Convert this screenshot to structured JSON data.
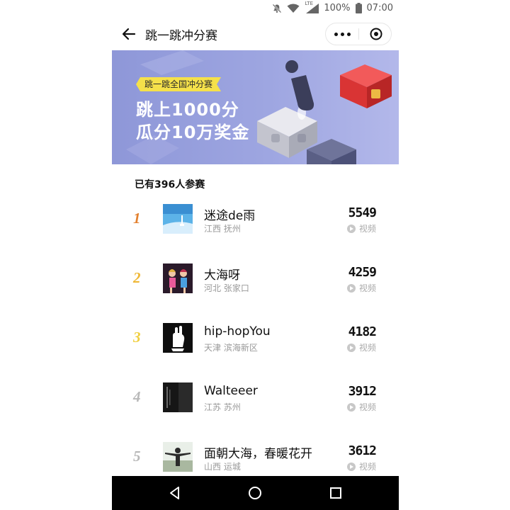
{
  "status_bar": {
    "battery": "100%",
    "time": "07:00",
    "network": "LTE"
  },
  "header": {
    "title": "跳一跳冲分赛"
  },
  "banner": {
    "ribbon": "跳一跳全国冲分赛",
    "line1": "跳上1000分",
    "line2": "瓜分10万奖金",
    "colors": {
      "background": "#9ea6e1",
      "ribbon": "#f5e14a"
    }
  },
  "participants": "已有396人参赛",
  "ranking": [
    {
      "rank": "1",
      "name": "迷途de雨",
      "location": "江西 抚州",
      "score": "5549",
      "video_label": "视频",
      "rank_color": "#e3812f"
    },
    {
      "rank": "2",
      "name": "大海呀",
      "location": "河北 张家口",
      "score": "4259",
      "video_label": "视频",
      "rank_color": "#efb735"
    },
    {
      "rank": "3",
      "name": "hip-hopYou",
      "location": "天津 滨海新区",
      "score": "4182",
      "video_label": "视频",
      "rank_color": "#f0cf3f"
    },
    {
      "rank": "4",
      "name": "Walteeer",
      "location": "江苏 苏州",
      "score": "3912",
      "video_label": "视频",
      "rank_color": "#b8b8b8"
    },
    {
      "rank": "5",
      "name": "面朝大海，春暖花开",
      "location": "山西 运城",
      "score": "3612",
      "video_label": "视频",
      "rank_color": "#b8b8b8"
    }
  ]
}
